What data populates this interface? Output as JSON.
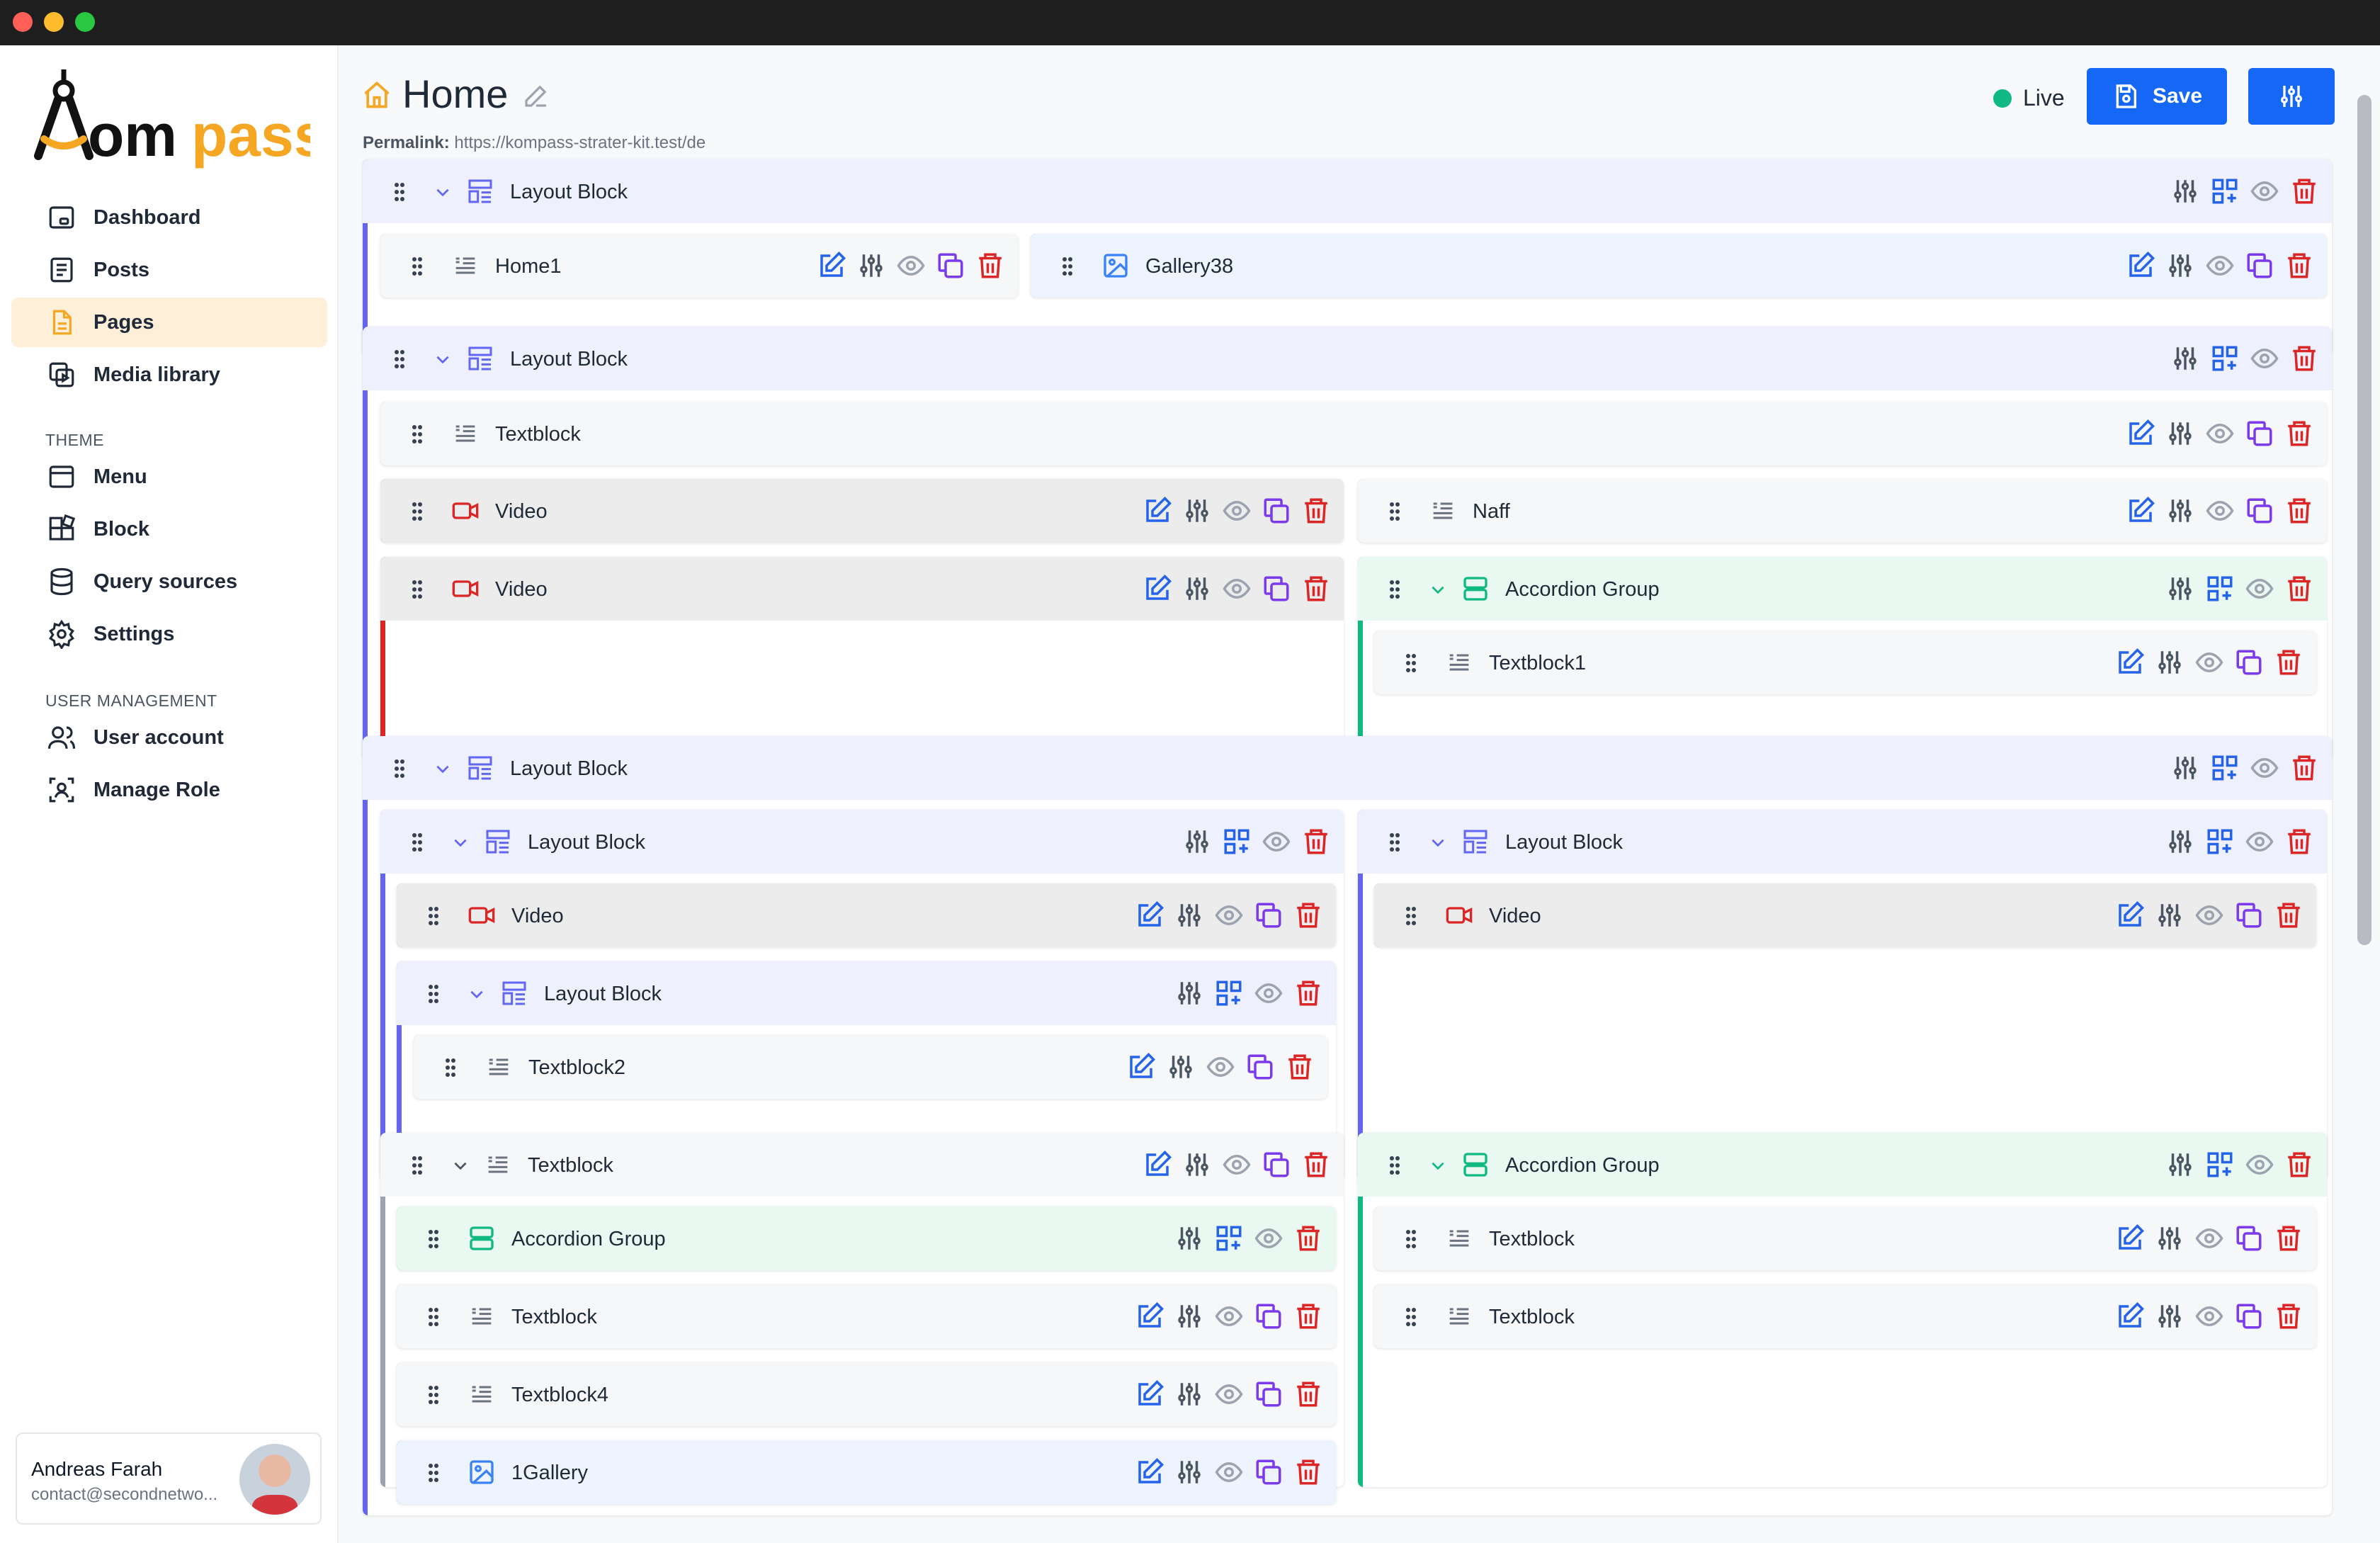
{
  "window": {
    "traffic_lights": [
      "#ff5f57",
      "#febc2e",
      "#28c840"
    ]
  },
  "brand": {
    "name": "Kompass",
    "colors": {
      "dark": "#111111",
      "accent": "#f5a623"
    }
  },
  "sidebar": {
    "items": [
      {
        "label": "Dashboard",
        "icon": "dashboard-icon"
      },
      {
        "label": "Posts",
        "icon": "posts-icon"
      },
      {
        "label": "Pages",
        "icon": "pages-icon",
        "active": true
      },
      {
        "label": "Media library",
        "icon": "media-icon"
      }
    ],
    "theme_label": "THEME",
    "theme_items": [
      {
        "label": "Menu",
        "icon": "menu-icon"
      },
      {
        "label": "Block",
        "icon": "block-icon"
      },
      {
        "label": "Query sources",
        "icon": "database-icon"
      },
      {
        "label": "Settings",
        "icon": "gear-icon"
      }
    ],
    "user_mgmt_label": "USER MANAGEMENT",
    "user_items": [
      {
        "label": "User account",
        "icon": "users-icon"
      },
      {
        "label": "Manage Role",
        "icon": "role-icon"
      }
    ],
    "user": {
      "name": "Andreas Farah",
      "email": "contact@secondnetwo..."
    }
  },
  "header": {
    "title": "Home",
    "permalink_label": "Permalink:",
    "permalink_url": "https://kompass-strater-kit.test/de",
    "status": "Live",
    "save_label": "Save"
  },
  "colors": {
    "layout": "#6366f1",
    "video": "#dc2626",
    "text": "#9ca3af",
    "gallery": "#3b82f6",
    "accordion": "#10b981",
    "edit": "#2563eb",
    "copy": "#7c3aed",
    "delete": "#dc2626",
    "icon_grey": "#4b5563"
  },
  "blocks": [
    {
      "label": "Layout Block",
      "type": "layout"
    },
    {
      "label": "Home1",
      "type": "text"
    },
    {
      "label": "Gallery38",
      "type": "gallery"
    },
    {
      "label": "Layout Block",
      "type": "layout"
    },
    {
      "label": "Textblock",
      "type": "text"
    },
    {
      "label": "Video",
      "type": "video"
    },
    {
      "label": "Naff",
      "type": "text"
    },
    {
      "label": "Video",
      "type": "video"
    },
    {
      "label": "Accordion Group",
      "type": "accordion"
    },
    {
      "label": "Textblock1",
      "type": "text"
    },
    {
      "label": "Layout Block",
      "type": "layout"
    },
    {
      "label": "Layout Block",
      "type": "layout"
    },
    {
      "label": "Layout Block",
      "type": "layout"
    },
    {
      "label": "Video",
      "type": "video"
    },
    {
      "label": "Video",
      "type": "video"
    },
    {
      "label": "Layout Block",
      "type": "layout"
    },
    {
      "label": "Textblock2",
      "type": "text"
    },
    {
      "label": "Textblock",
      "type": "text"
    },
    {
      "label": "Accordion Group",
      "type": "accordion"
    },
    {
      "label": "Accordion Group",
      "type": "accordion"
    },
    {
      "label": "Textblock",
      "type": "text"
    },
    {
      "label": "Textblock",
      "type": "text"
    },
    {
      "label": "Textblock",
      "type": "text"
    },
    {
      "label": "Textblock4",
      "type": "text"
    },
    {
      "label": "1Gallery",
      "type": "gallery"
    }
  ]
}
